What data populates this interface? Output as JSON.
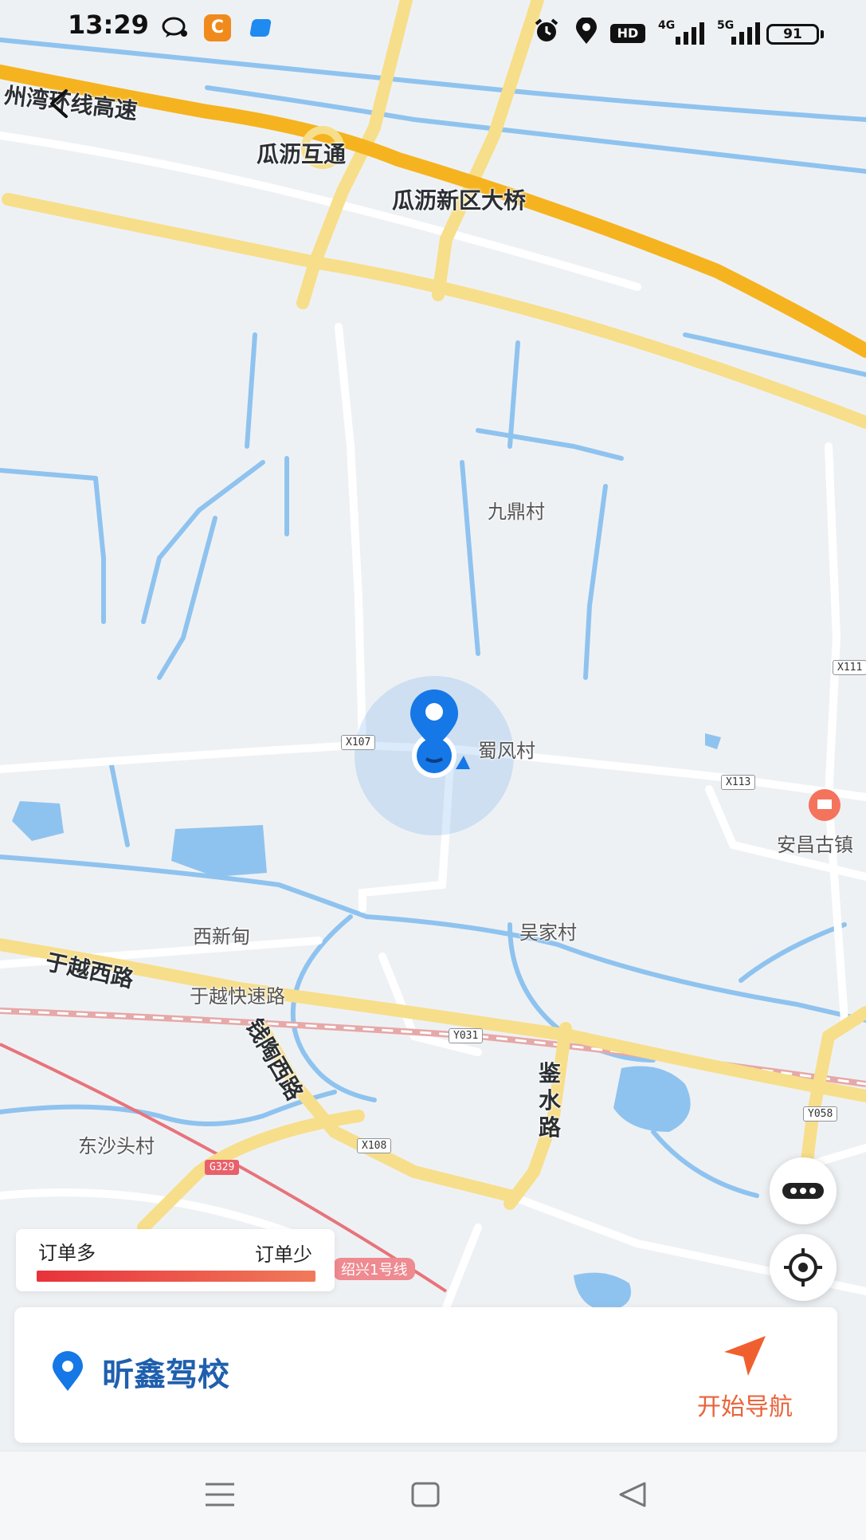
{
  "status_bar": {
    "time": "13:29",
    "icons": [
      "chat-bubble-icon",
      "app-c-icon",
      "app-blue-icon",
      "alarm-icon",
      "location-icon"
    ],
    "hd_label": "HD",
    "network_1": "4G",
    "network_2": "5G",
    "battery": "91"
  },
  "map": {
    "labels": {
      "expressway": "州湾环线高速",
      "guali_interchange": "瓜沥互通",
      "guali_bridge": "瓜沥新区大桥",
      "jiuding": "九鼎村",
      "shufeng": "蜀风村",
      "anchang": "安昌古镇",
      "xixindian": "西新甸",
      "wujia": "吴家村",
      "yuyue_west": "于越西路",
      "yuyue_express": "于越快速路",
      "qiantao_west": "钱陶西路",
      "jianshui": "鉴水路",
      "dongshatou": "东沙头村",
      "shaoxing_line1": "绍兴1号线"
    },
    "road_badges": {
      "x107": "X107",
      "x113": "X113",
      "x111": "X111",
      "y031": "Y031",
      "y058": "Y058",
      "x108": "X108",
      "g329": "G329"
    },
    "colors": {
      "background": "#eef1f4",
      "water": "#8fc3ef",
      "major_road": "#f7de8a",
      "expressway": "#f5b31f",
      "location_blue": "#1677e6"
    }
  },
  "legend": {
    "high": "订单多",
    "low": "订单少"
  },
  "destination": {
    "name": "昕鑫驾校",
    "nav_label": "开始导航"
  }
}
